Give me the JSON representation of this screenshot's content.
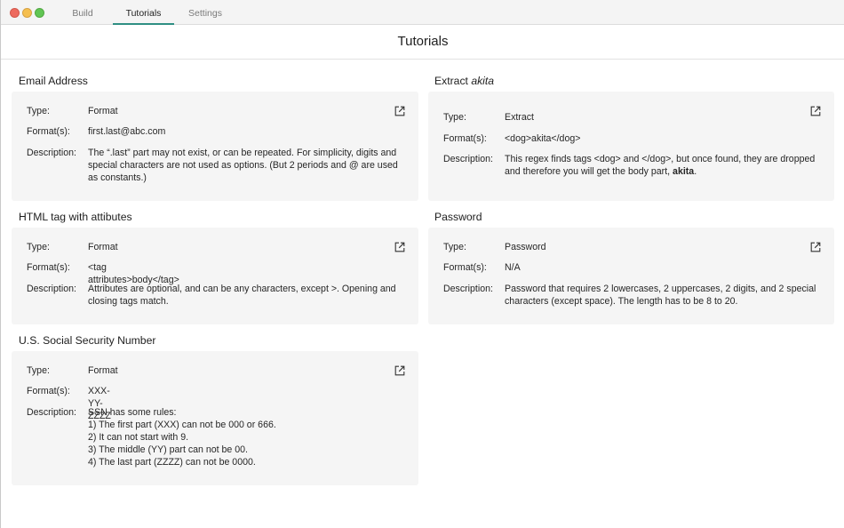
{
  "tabs": [
    {
      "label": "Build"
    },
    {
      "label": "Tutorials"
    },
    {
      "label": "Settings"
    }
  ],
  "page_title": "Tutorials",
  "labels": {
    "type": "Type:",
    "formats": "Format(s):",
    "description": "Description:"
  },
  "cards": {
    "email": {
      "title": "Email Address",
      "type": "Format",
      "formats": "first.last@abc.com",
      "description": [
        "The “.last” part may not exist, or can be repeated.  For simplicity, digits and",
        "special characters are not used as options.  (But 2 periods and @ are used",
        "as constants.)"
      ]
    },
    "extract": {
      "title_prefix": "Extract ",
      "title_italic": "akita",
      "type": "Extract",
      "formats": "<dog>akita</dog>",
      "description_line1": "This regex finds tags <dog> and </dog>, but once found, they are dropped",
      "description_line2_prefix": "and therefore you will get the body part, ",
      "description_line2_bold": "akita",
      "description_line2_suffix": "."
    },
    "html": {
      "title": "HTML tag with attibutes",
      "type": "Format",
      "formats": "<tag attributes>body</tag>",
      "description": [
        "Attributes are optional, and can be any characters, except >.  Opening and",
        "closing tags match."
      ]
    },
    "password": {
      "title": "Password",
      "type": "Password",
      "formats": "N/A",
      "description": [
        "Password that requires 2 lowercases, 2 uppercases, 2 digits, and 2 special",
        "characters (except space).  The length has to be 8 to 20."
      ]
    },
    "ssn": {
      "title": "U.S. Social Security Number",
      "type": "Format",
      "formats": "XXX-YY-ZZZZ",
      "description": [
        "SSN has some rules:",
        "1) The first part (XXX) can not be 000 or 666.",
        "2) It can not start with 9.",
        "3) The middle (YY) part can not be 00.",
        "4) The last part (ZZZZ) can not be 0000."
      ]
    }
  },
  "icons": {
    "open": "external-link-icon"
  },
  "colors": {
    "accent": "#2f8f83",
    "card_bg": "#f5f5f5"
  }
}
